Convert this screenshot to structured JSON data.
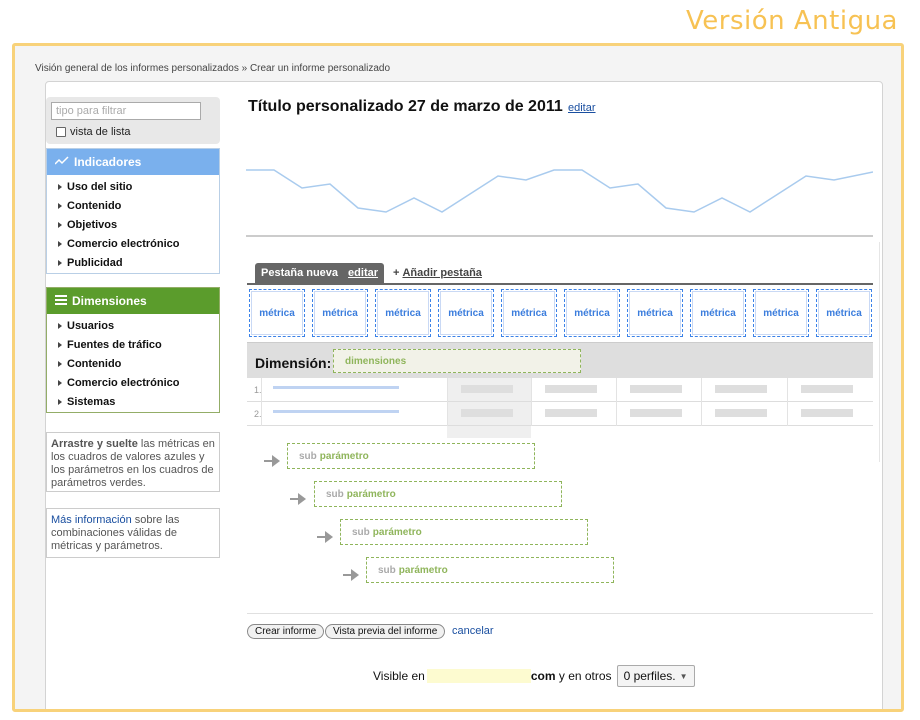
{
  "version_label": "Versión Antigua",
  "breadcrumb": "Visión general de los informes personalizados » Crear un informe personalizado",
  "sidebar": {
    "filter_placeholder": "tipo para filtrar",
    "list_view_label": "vista de lista",
    "indicators": {
      "title": "Indicadores",
      "items": [
        "Uso del sitio",
        "Contenido",
        "Objetivos",
        "Comercio electrónico",
        "Publicidad"
      ]
    },
    "dimensions": {
      "title": "Dimensiones",
      "items": [
        "Usuarios",
        "Fuentes de tráfico",
        "Contenido",
        "Comercio electrónico",
        "Sistemas"
      ]
    },
    "help_drag": {
      "bold": "Arrastre y suelte",
      "text": " las métricas en los cuadros de valores azules y los parámetros en los cuadros de parámetros verdes."
    },
    "help_more": {
      "link": "Más información",
      "text": " sobre las combinaciones válidas de métricas y parámetros."
    }
  },
  "report": {
    "title": "Título personalizado 27 de marzo de 2011",
    "edit_label": "editar"
  },
  "tabs": {
    "active": "Pestaña nueva",
    "edit": "editar",
    "add_prefix": "+",
    "add": "Añadir pestaña"
  },
  "metrics": [
    "métrica",
    "métrica",
    "métrica",
    "métrica",
    "métrica",
    "métrica",
    "métrica",
    "métrica",
    "métrica",
    "métrica"
  ],
  "dimension": {
    "label": "Dimensión:",
    "drop": "dimensiones"
  },
  "table_rows": [
    "1.",
    "2."
  ],
  "subparams": [
    {
      "prefix": "sub",
      "label": "parámetro"
    },
    {
      "prefix": "sub",
      "label": "parámetro"
    },
    {
      "prefix": "sub",
      "label": "parámetro"
    },
    {
      "prefix": "sub",
      "label": "parámetro"
    }
  ],
  "buttons": {
    "create": "Crear informe",
    "preview": "Vista previa del informe",
    "cancel": "cancelar"
  },
  "visibility": {
    "prefix": "Visible en",
    "domain_suffix": "com",
    "middle": "y en otros",
    "profiles": "0 perfiles."
  },
  "colors": {
    "accent_label": "#f7c253",
    "metric_blue": "#3b82e8",
    "dimension_green": "#8fb55b",
    "indicators_head": "#7ab0ed",
    "dimensions_head": "#5b9c2c"
  }
}
